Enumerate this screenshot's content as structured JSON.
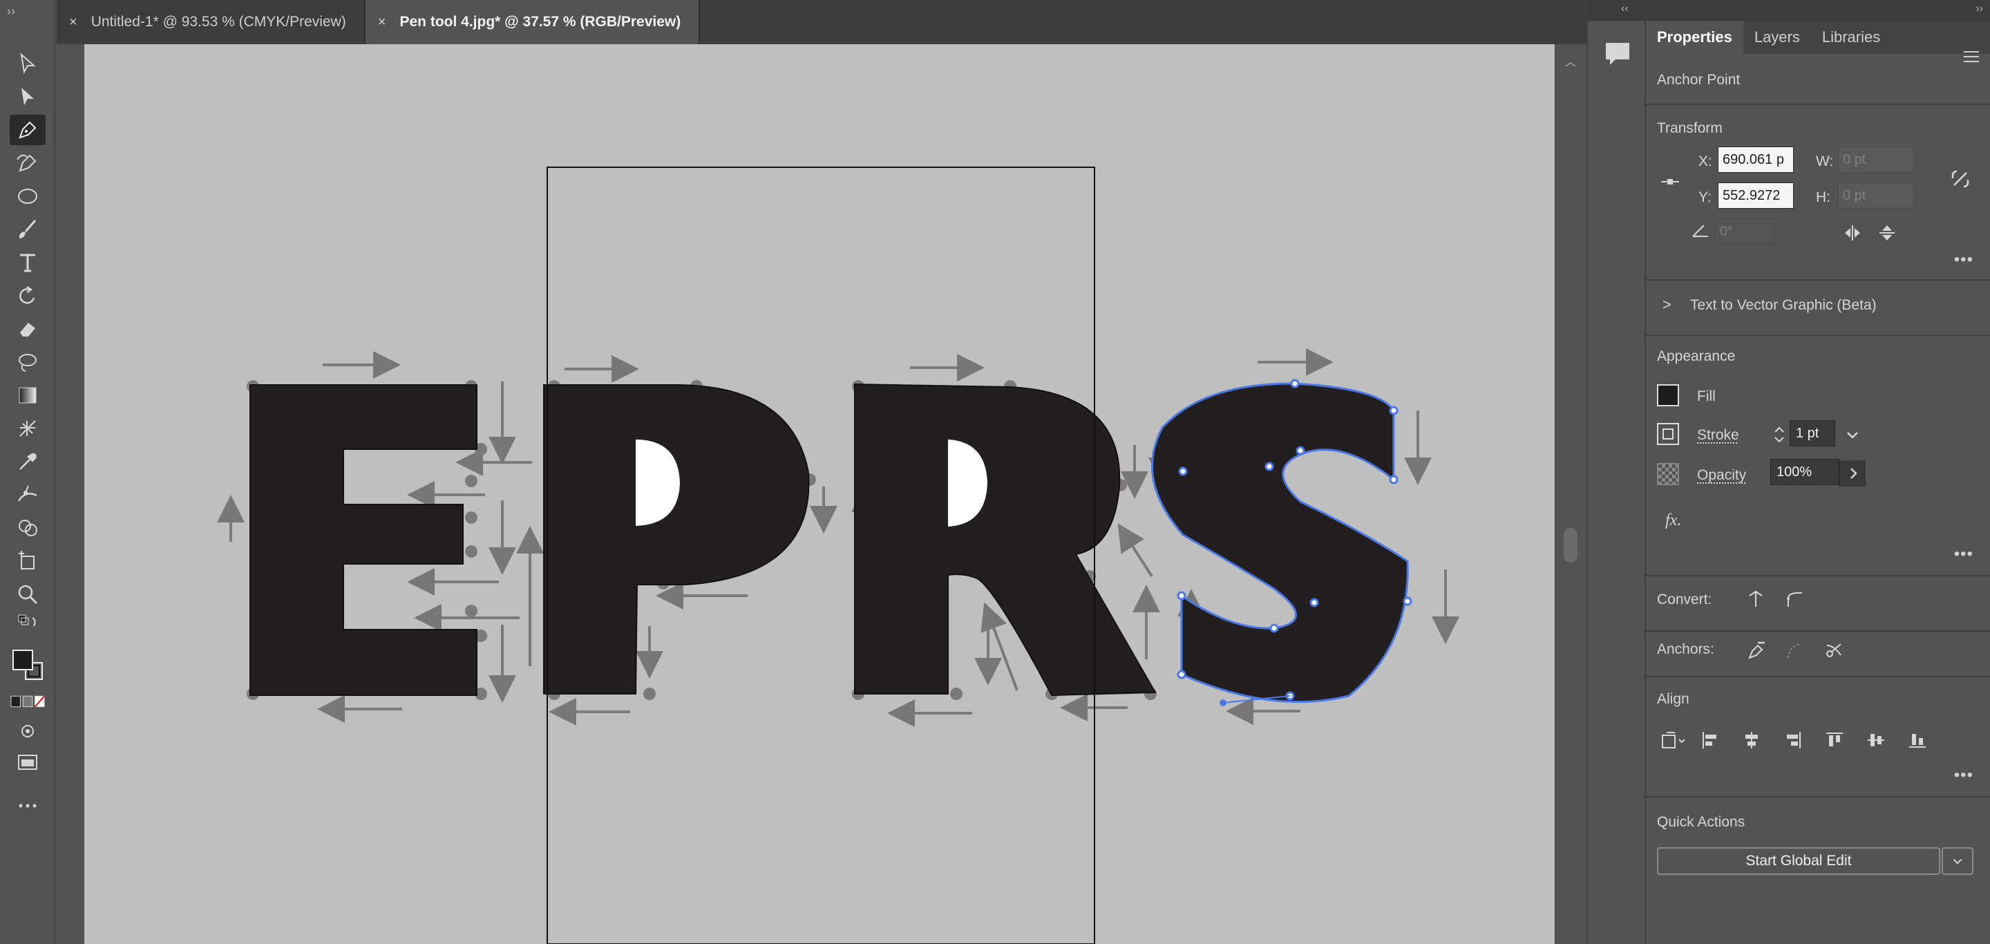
{
  "tabs": [
    {
      "label": "Untitled-1* @ 93.53 % (CMYK/Preview)",
      "active": false
    },
    {
      "label": "Pen tool 4.jpg* @ 37.57 % (RGB/Preview)",
      "active": true
    }
  ],
  "tab_close_glyph": "×",
  "artwork": {
    "letters": [
      "E",
      "P",
      "R",
      "S"
    ]
  },
  "tools": [
    "selection-tool-icon",
    "direct-selection-tool-icon",
    "pen-tool-icon",
    "curvature-tool-icon",
    "ellipse-tool-icon",
    "paintbrush-tool-icon",
    "type-tool-icon",
    "rotate-tool-icon",
    "eraser-tool-icon",
    "lasso-tool-icon",
    "gradient-tool-icon",
    "mesh-tool-icon",
    "eyedropper-tool-icon",
    "puppet-warp-tool-icon",
    "shape-builder-tool-icon",
    "artboard-tool-icon",
    "zoom-tool-icon",
    "fill-stroke-icon",
    "draw-mode-icon",
    "screen-mode-icon",
    "more-tools-icon"
  ],
  "panel": {
    "tabs": [
      "Properties",
      "Layers",
      "Libraries"
    ],
    "selection_type": "Anchor Point",
    "transform": {
      "title": "Transform",
      "x_label": "X:",
      "x_value": "690.061 p",
      "y_label": "Y:",
      "y_value": "552.9272",
      "w_label": "W:",
      "w_placeholder": "0 pt",
      "h_label": "H:",
      "h_placeholder": "0 pt",
      "angle_value": "0°"
    },
    "text_to_vector": "Text to Vector Graphic (Beta)",
    "appearance": {
      "title": "Appearance",
      "fill_label": "Fill",
      "stroke_label": "Stroke",
      "stroke_value": "1 pt",
      "opacity_label": "Opacity",
      "opacity_value": "100%",
      "fx_label": "fx."
    },
    "convert_label": "Convert:",
    "anchors_label": "Anchors:",
    "align_title": "Align",
    "quick_actions": {
      "title": "Quick Actions",
      "button": "Start Global Edit"
    }
  },
  "colors": {
    "accent_path": "#4a78e6",
    "letter_fill": "#231f20",
    "artboard_bg": "#bfbfbf",
    "panel_bg": "#535353"
  }
}
